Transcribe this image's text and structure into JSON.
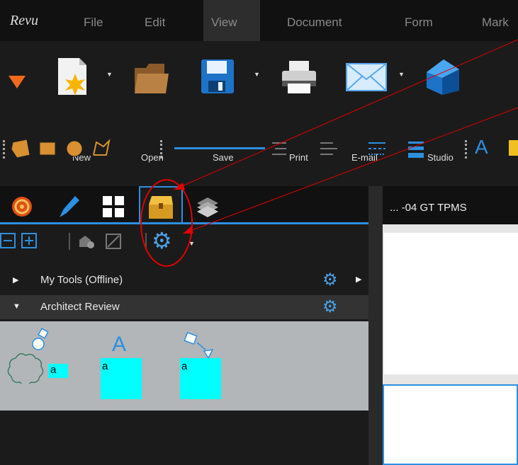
{
  "menubar": {
    "logo": "Revu",
    "items": [
      "File",
      "Edit",
      "View",
      "Document",
      "Form",
      "Mark"
    ],
    "active": "View"
  },
  "ribbon": {
    "buttons": [
      "New",
      "Open",
      "Save",
      "Print",
      "E-mail",
      "Studio"
    ]
  },
  "panel": {
    "sections": [
      {
        "label": "My Tools (Offline)",
        "expanded": false
      },
      {
        "label": "Architect Review",
        "expanded": true
      }
    ],
    "tool_labels": [
      "a",
      "a",
      "a"
    ]
  },
  "document": {
    "tab_title": "... -04 GT TPMS"
  },
  "colors": {
    "accent_blue": "#2d8fe0",
    "cyan_fill": "#00ffff",
    "annotation_red": "#e00000"
  }
}
